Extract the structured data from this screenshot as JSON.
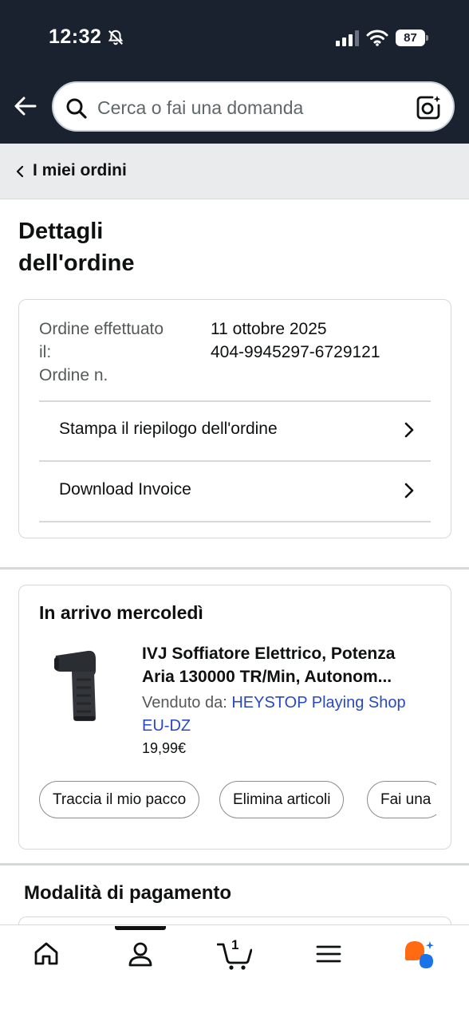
{
  "status_bar": {
    "time": "12:32",
    "battery": "87"
  },
  "search": {
    "placeholder": "Cerca o fai una domanda"
  },
  "breadcrumb": {
    "label": "I miei ordini"
  },
  "page": {
    "title_line1": "Dettagli",
    "title_line2": "dell'ordine"
  },
  "order_summary": {
    "date_label_line1": "Ordine effettuato",
    "date_label_line2": "il:",
    "date_value": "11 ottobre 2025",
    "number_label": "Ordine n.",
    "number_value": "404-9945297-6729121",
    "links": [
      "Stampa il riepilogo dell'ordine",
      "Download Invoice"
    ]
  },
  "shipment": {
    "arrival": "In arrivo mercoledì",
    "product_title_line1": "IVJ Soffiatore Elettrico, Potenza",
    "product_title_line2": "Aria 130000 TR/Min, Autonom...",
    "seller_prefix": "Venduto da:",
    "seller_name": "HEYSTOP Playing Shop EU-DZ",
    "price": "19,99€",
    "actions": [
      "Traccia il mio pacco",
      "Elimina articoli",
      "Fai una"
    ]
  },
  "payment": {
    "title": "Modalità di pagamento"
  },
  "bottom_nav": {
    "items": [
      "home-icon",
      "account-icon",
      "cart-icon",
      "menu-icon",
      "rufus-assistant-icon"
    ],
    "cart_count": "1"
  },
  "colors": {
    "header_bg": "#1a2230",
    "link": "#2a49c0",
    "assistant_orange": "#ff6a13",
    "assistant_blue": "#1a73e8"
  }
}
